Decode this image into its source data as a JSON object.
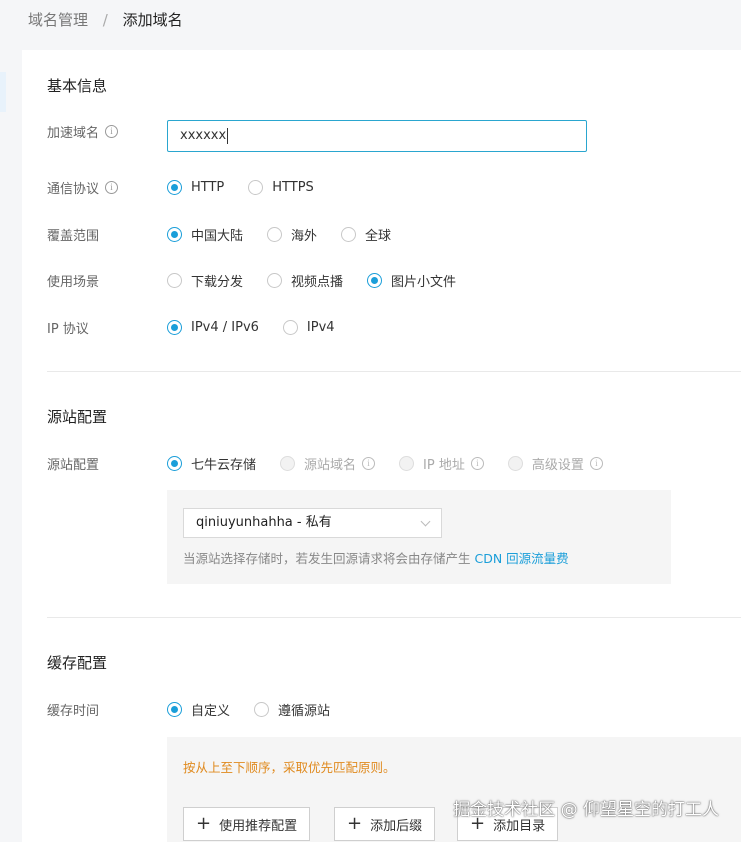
{
  "breadcrumb": {
    "parent": "域名管理",
    "separator": "/",
    "current": "添加域名"
  },
  "basic": {
    "title": "基本信息",
    "domain": {
      "label": "加速域名",
      "value": "xxxxxx"
    },
    "protocol": {
      "label": "通信协议",
      "options": [
        "HTTP",
        "HTTPS"
      ],
      "selected": "HTTP"
    },
    "coverage": {
      "label": "覆盖范围",
      "options": [
        "中国大陆",
        "海外",
        "全球"
      ],
      "selected": "中国大陆"
    },
    "scenario": {
      "label": "使用场景",
      "options": [
        "下载分发",
        "视频点播",
        "图片小文件"
      ],
      "selected": "图片小文件"
    },
    "ip": {
      "label": "IP 协议",
      "options": [
        "IPv4 / IPv6",
        "IPv4"
      ],
      "selected": "IPv4 / IPv6"
    }
  },
  "origin": {
    "title": "源站配置",
    "label": "源站配置",
    "options": [
      "七牛云存储",
      "源站域名",
      "IP 地址",
      "高级设置"
    ],
    "selected": "七牛云存储",
    "bucket_select": "qiniuyunhahha - 私有",
    "note_prefix": "当源站选择存储时，若发生回源请求将会由存储产生",
    "note_link": "CDN 回源流量费"
  },
  "cache": {
    "title": "缓存配置",
    "label": "缓存时间",
    "options": [
      "自定义",
      "遵循源站"
    ],
    "selected": "自定义",
    "note": "按从上至下顺序，采取优先匹配原则。",
    "buttons": [
      "使用推荐配置",
      "添加后缀",
      "添加目录"
    ]
  },
  "watermark": "掘金技术社区 @ 仰望星空的打工人",
  "colors": {
    "accent": "#1a9ed9",
    "input_border": "#2aa6cf",
    "warning": "#e08a1e"
  }
}
